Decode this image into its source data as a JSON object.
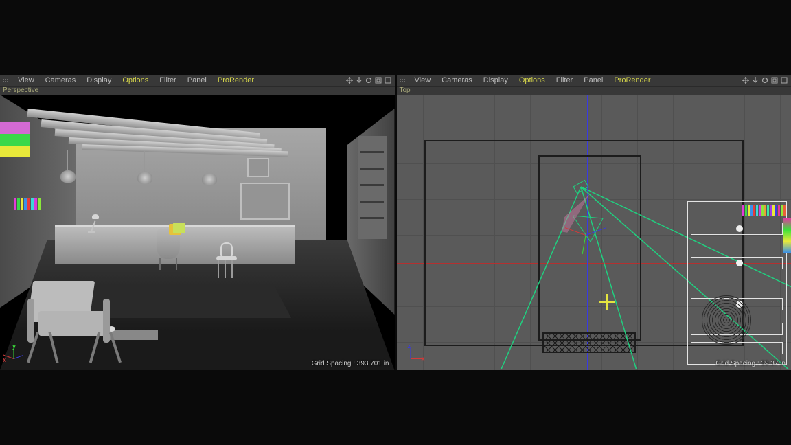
{
  "menus": {
    "view": "View",
    "cameras": "Cameras",
    "display": "Display",
    "options": "Options",
    "filter": "Filter",
    "panel": "Panel",
    "prorender": "ProRender"
  },
  "icons": {
    "move": "move-icon",
    "drop": "drop-down-icon",
    "rotate": "rotate-icon",
    "frame": "frame-icon",
    "maximize": "maximize-icon"
  },
  "viewports": {
    "left": {
      "label": "Perspective",
      "grid_spacing": "Grid Spacing : 393.701 in",
      "axes": {
        "x": "x",
        "y": "y"
      }
    },
    "right": {
      "label": "Top",
      "grid_spacing": "Grid Spacing : 39.37 in",
      "axes": {
        "x": "x",
        "z": "z"
      }
    }
  },
  "colors": {
    "menu_highlight": "#d7d74a",
    "axis_x": "#d43a3a",
    "axis_y": "#3ad83a",
    "axis_z": "#3a3ae0",
    "camera_frustum": "#20d080",
    "light_cross": "#e4e440"
  }
}
